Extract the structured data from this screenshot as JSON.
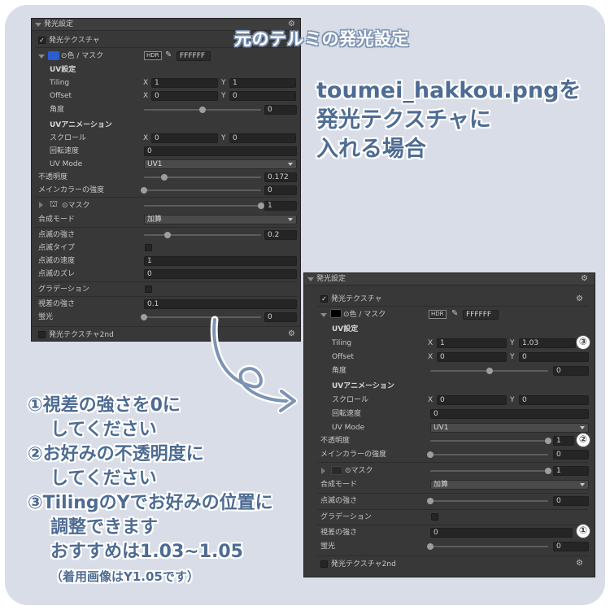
{
  "annotations": {
    "title": "元のテルミの発光設定",
    "note_lines": [
      "toumei_hakkou.pngを",
      "発光テクスチャに",
      "入れる場合"
    ],
    "steps": [
      "①視差の強さを0に",
      "してください",
      "②お好みの不透明度に",
      "してください",
      "③TilingのYでお好みの位置に",
      "調整できます",
      "おすすめは1.03~1.05",
      "（着用画像はY1.05です）"
    ]
  },
  "panel1": {
    "section": "発光設定",
    "texture_label": "発光テクスチャ",
    "color_mask_label": "⊙色 / マスク",
    "hdr": "HDR",
    "hex": "FFFFFF",
    "uv_settings": "UV設定",
    "tiling": "Tiling",
    "tiling_x": "1",
    "tiling_y": "1",
    "offset": "Offset",
    "offset_x": "0",
    "offset_y": "0",
    "angle": "角度",
    "angle_value": "0",
    "uv_anim": "UVアニメーション",
    "scroll": "スクロール",
    "scroll_x": "0",
    "scroll_y": "0",
    "rotation": "回転速度",
    "rotation_value": "0",
    "uv_mode": "UV Mode",
    "uv_mode_value": "UV1",
    "opacity": "不透明度",
    "opacity_value": "0.172",
    "main_color_strength": "メインカラーの強度",
    "main_color_value": "0",
    "mask_label": "⊙マスク",
    "mask_value": "1",
    "blend_mode": "合成モード",
    "blend_mode_value": "加算",
    "blink_strength": "点滅の強さ",
    "blink_strength_value": "0.2",
    "blink_type": "点滅タイプ",
    "blink_speed": "点滅の速度",
    "blink_speed_value": "1",
    "blink_offset": "点滅のズレ",
    "blink_offset_value": "0",
    "gradation": "グラデーション",
    "parallax": "視差の強さ",
    "parallax_value": "0.1",
    "fluorescence": "蛍光",
    "fluorescence_value": "0",
    "texture2": "発光テクスチャ2nd",
    "xlabel": "X",
    "ylabel": "Y"
  },
  "panel2": {
    "section": "発光設定",
    "texture_label": "発光テクスチャ",
    "color_mask_label": "⊙色 / マスク",
    "hdr": "HDR",
    "hex": "FFFFFF",
    "uv_settings": "UV設定",
    "tiling": "Tiling",
    "tiling_x": "1",
    "tiling_y": "1.03",
    "offset": "Offset",
    "offset_x": "0",
    "offset_y": "0",
    "angle": "角度",
    "angle_value": "0",
    "uv_anim": "UVアニメーション",
    "scroll": "スクロール",
    "scroll_x": "0",
    "scroll_y": "0",
    "rotation": "回転速度",
    "rotation_value": "0",
    "uv_mode": "UV Mode",
    "uv_mode_value": "UV1",
    "opacity": "不透明度",
    "opacity_value": "1",
    "main_color_strength": "メインカラーの強度",
    "main_color_value": "0",
    "mask_label": "⊙マスク",
    "mask_value": "1",
    "blend_mode": "合成モード",
    "blend_mode_value": "加算",
    "blink_strength": "点滅の強さ",
    "blink_strength_value": "0",
    "gradation": "グラデーション",
    "parallax": "視差の強さ",
    "parallax_value": "0",
    "fluorescence": "蛍光",
    "fluorescence_value": "0",
    "texture2": "発光テクスチャ2nd",
    "xlabel": "X",
    "ylabel": "Y",
    "badges": [
      "③",
      "②",
      "①"
    ]
  },
  "colors": {
    "accent": "#4e6c93",
    "panel_bg": "#383838",
    "card_bg": "#d9dde7"
  }
}
